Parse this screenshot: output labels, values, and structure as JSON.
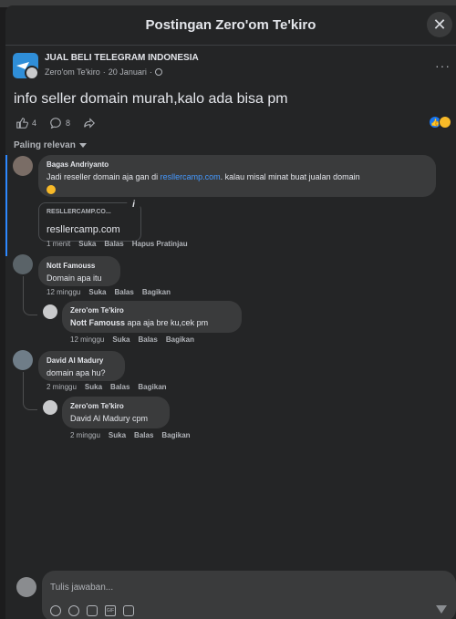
{
  "modal": {
    "title": "Postingan Zero'om Te'kiro",
    "close_icon": "close-icon"
  },
  "post": {
    "group_name": "JUAL BELI TELEGRAM INDONESIA",
    "author": "Zero'om Te'kiro",
    "date": "20 Januari",
    "separator": "·",
    "privacy_icon": "globe-icon",
    "more_label": "···",
    "text": "info seller domain murah,kalo ada bisa pm",
    "like_count": "4",
    "comment_count": "8",
    "reactions": [
      "like",
      "haha"
    ]
  },
  "filter": {
    "label": "Paling relevan"
  },
  "comments": [
    {
      "author": "Bagas Andriyanto",
      "text_before": "Jadi reseller domain aja gan di ",
      "link": "resllercamp.com",
      "text_after": ". kalau misal minat buat jualan domain",
      "emoji": "grinning-face-emoji",
      "preview": {
        "domain": "RESLLERCAMP.CO...",
        "title": "resllercamp.com"
      },
      "actions": {
        "time": "1 menit",
        "like": "Suka",
        "reply": "Balas",
        "extra": "Hapus Pratinjau"
      }
    },
    {
      "author": "Nott Famouss",
      "text": "Domain apa itu",
      "actions": {
        "time": "12 minggu",
        "like": "Suka",
        "reply": "Balas",
        "extra": "Bagikan"
      },
      "reply": {
        "author": "Zero'om Te'kiro",
        "mention": "Nott Famouss",
        "text": " apa aja bre ku,cek pm",
        "actions": {
          "time": "12 minggu",
          "like": "Suka",
          "reply": "Balas",
          "extra": "Bagikan"
        }
      }
    },
    {
      "author": "David Al Madury",
      "text": "domain apa hu?",
      "actions": {
        "time": "2 minggu",
        "like": "Suka",
        "reply": "Balas",
        "extra": "Bagikan"
      },
      "reply": {
        "author": "Zero'om Te'kiro",
        "text": "David Al Madury cpm",
        "actions": {
          "time": "2 minggu",
          "like": "Suka",
          "reply": "Balas",
          "extra": "Bagikan"
        }
      }
    }
  ],
  "composer": {
    "placeholder": "Tulis jawaban...",
    "tools": [
      "avatar-sticker-icon",
      "emoji-icon",
      "camera-icon",
      "gif-icon",
      "sticker-icon"
    ],
    "gif_label": "GIF"
  },
  "colors": {
    "background": "#242526",
    "bubble": "#3a3b3c",
    "link": "#4599ff",
    "accent": "#2d88ff"
  }
}
